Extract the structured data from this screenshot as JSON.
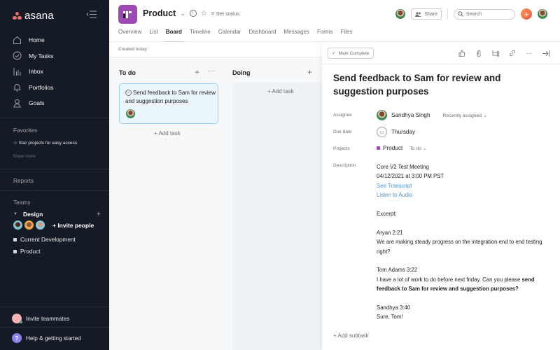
{
  "app": {
    "name": "asana"
  },
  "sidebar": {
    "nav": [
      {
        "label": "Home",
        "icon": "home-icon"
      },
      {
        "label": "My Tasks",
        "icon": "check-circle-icon"
      },
      {
        "label": "Inbox",
        "icon": "inbox-icon"
      },
      {
        "label": "Portfolios",
        "icon": "bell-icon"
      },
      {
        "label": "Goals",
        "icon": "goals-icon"
      }
    ],
    "favorites_label": "Favorites",
    "favorites_hint": "☆ Star projects for easy access",
    "show_more": "Show more",
    "reports_label": "Reports",
    "teams_label": "Teams",
    "team_name": "Design",
    "invite_people": "+ Invite people",
    "projects": [
      "Current Development",
      "Product"
    ],
    "invite_teammates": "Invite teammates",
    "help": "Help & getting started"
  },
  "header": {
    "project_title": "Product",
    "set_status": "Set status",
    "tabs": [
      "Overview",
      "List",
      "Board",
      "Timeline",
      "Calendar",
      "Dashboard",
      "Messages",
      "Forms",
      "Files"
    ],
    "active_tab": "Board",
    "share_label": "Share",
    "search_placeholder": "Search",
    "created": "Created today"
  },
  "board": {
    "columns": [
      {
        "title": "To do",
        "tasks": [
          {
            "title": "Send feedback to Sam for review and suggestion purposes"
          }
        ],
        "add_task": "+ Add task"
      },
      {
        "title": "Doing",
        "tasks": [],
        "add_task": "+ Add task"
      }
    ]
  },
  "detail": {
    "mark_complete": "Mark Complete",
    "title": "Send feedback to Sam for review and suggestion purposes",
    "assignee_label": "Assignee",
    "assignee": "Sandhya Singh",
    "recently_assigned": "Recently assigned ⌄",
    "due_label": "Due date",
    "due": "Thursday",
    "projects_label": "Projects",
    "project": "Product",
    "section": "To do ⌄",
    "description_label": "Description",
    "description": {
      "line1": "Core V2 Test Meeting",
      "line2": "04/12/2021 at 3:00 PM PST",
      "link1": "See Transcript",
      "link2": "Listen to Audio",
      "excerpt": "Excerpt:",
      "s1_head": "Aryan 2:21",
      "s1_text": "We are making steady progress on the integration end to end testing right?",
      "s2_head": "Tom Adams 3:22",
      "s2_text": "I have a lot of work to do before next friday. Can you please ",
      "s2_bold": "send feedback to Sam for review and suggestion purposes?",
      "s3_head": "Sandhya 3:40",
      "s3_text": "Sure, Tom!"
    },
    "add_subtask": "+ Add subtask"
  },
  "colors": {
    "accent": "#f06a6a",
    "project": "#9e4ab5",
    "sidebar_bg": "#151b26",
    "link": "#4a90c8"
  }
}
